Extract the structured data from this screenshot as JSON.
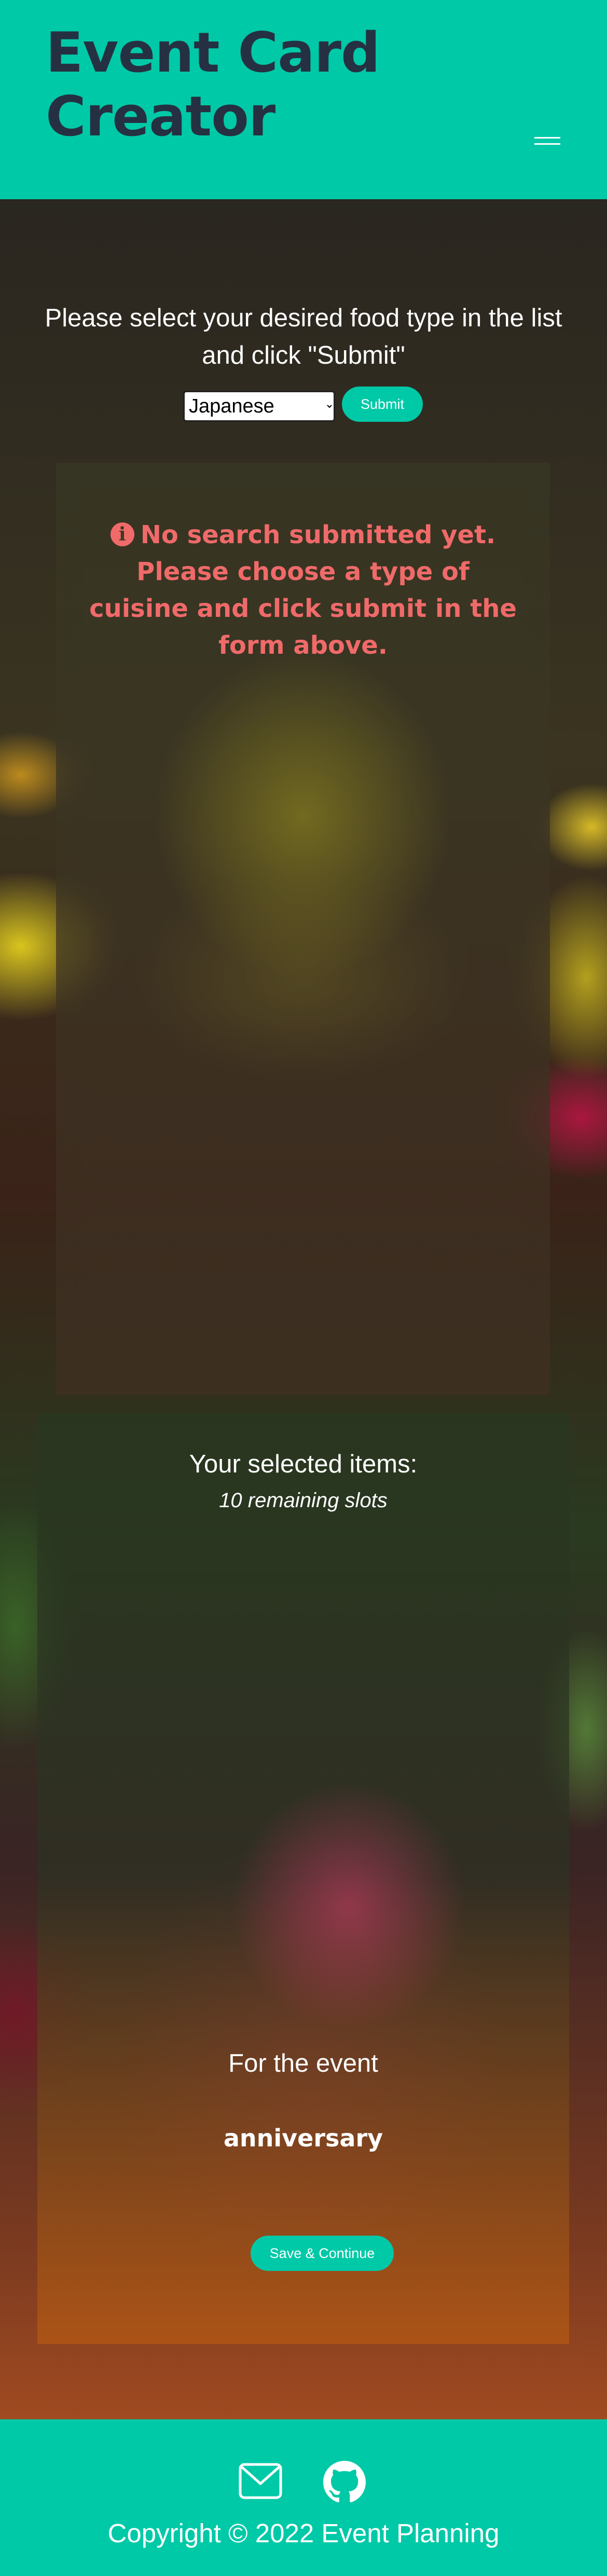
{
  "header": {
    "title": "Event Card Creator",
    "menu_icon": "hamburger-menu-icon"
  },
  "search": {
    "instructions": "Please select your desired food type in the list and click \"Submit\"",
    "selected_cuisine": "Japanese",
    "submit_label": "Submit"
  },
  "results": {
    "icon": "info-circle-icon",
    "message": "No search submitted yet. Please choose a type of cuisine and click submit in the form above."
  },
  "selection": {
    "heading": "Your selected items:",
    "remaining": "10 remaining slots",
    "event_label": "For the event",
    "event_name": "anniversary",
    "save_label": "Save & Continue"
  },
  "footer": {
    "icons": [
      "mail-icon",
      "github-icon"
    ],
    "copyright": "Copyright © 2022 Event Planning"
  },
  "colors": {
    "accent": "#00c9a7",
    "title_text": "#253142",
    "error_text": "#f06a6a"
  }
}
